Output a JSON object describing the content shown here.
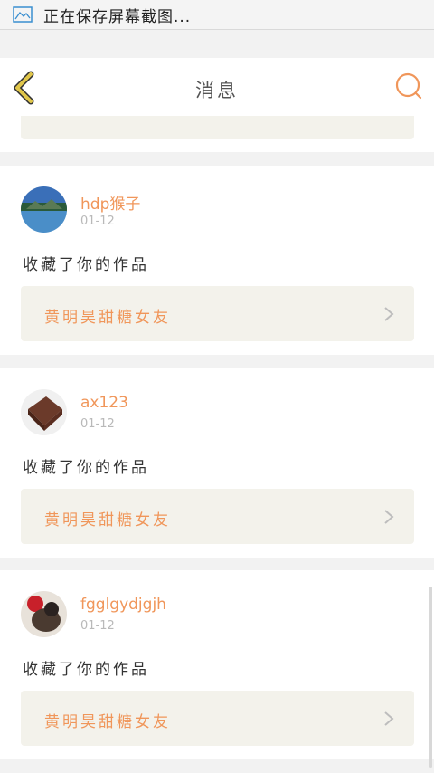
{
  "status_bar": {
    "text": "正在保存屏幕截图..."
  },
  "header": {
    "title": "消息"
  },
  "partial_card": {
    "work_title": "黄明昊甜糖女友"
  },
  "messages": [
    {
      "username": "hdp猴子",
      "date": "01-12",
      "action": "收藏了你的作品",
      "work_title": "黄明昊甜糖女友"
    },
    {
      "username": "ax123",
      "date": "01-12",
      "action": "收藏了你的作品",
      "work_title": "黄明昊甜糖女友"
    },
    {
      "username": "fgglgydjgjh",
      "date": "01-12",
      "action": "收藏了你的作品",
      "work_title": "黄明昊甜糖女友"
    }
  ],
  "colors": {
    "accent": "#f0965a",
    "back_arrow": "#e0c64a",
    "link_bg": "#f3f2eb"
  }
}
